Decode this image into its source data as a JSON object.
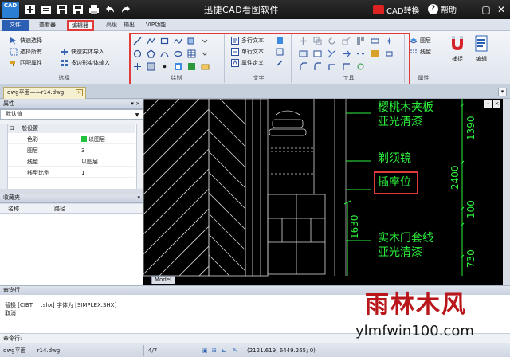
{
  "window": {
    "title": "迅捷CAD看图软件",
    "cad_convert": "CAD转换",
    "help": "帮助",
    "logo": "CAD"
  },
  "menu": {
    "tabs": [
      "文件",
      "查看器",
      "编辑器",
      "高级",
      "输出",
      "VIP功能"
    ],
    "active": "编辑器"
  },
  "ribbon": {
    "select_group": {
      "label": "选择",
      "items": [
        "快速选择",
        "选择所有",
        "匹配属性"
      ],
      "items_right": [
        "快速实体导入",
        "多边形实体输入"
      ]
    },
    "draw_group": {
      "label": "绘制"
    },
    "text_group": {
      "label": "文字",
      "items": [
        "多行文本",
        "单行文本",
        "属性定义"
      ]
    },
    "tools_group": {
      "label": "工具"
    },
    "props_group": {
      "label": "属性",
      "items": [
        "图层",
        "线型"
      ]
    },
    "capture_label": "捕捉",
    "edit_label": "编辑"
  },
  "doc_tab": {
    "label": "dwg平面——r14.dwg"
  },
  "properties_panel": {
    "title": "属性",
    "selector": "默认值",
    "category": "一般设置",
    "rows": [
      {
        "key": "色彩",
        "value": "以图层",
        "swatch": "#1fc23a"
      },
      {
        "key": "图层",
        "value": "3"
      },
      {
        "key": "线型",
        "value": "以图层"
      },
      {
        "key": "线型比例",
        "value": "1"
      }
    ]
  },
  "favorites_panel": {
    "title": "收藏夹",
    "columns": [
      "名称",
      "路径"
    ]
  },
  "drawing": {
    "labels": [
      "樱桃木夹板",
      "亚光清漆",
      "剃须镜",
      "插座位",
      "实木门套线",
      "亚光清漆"
    ],
    "dims": [
      "1390",
      "2400",
      "100",
      "730",
      "1630"
    ],
    "model_tab": "Model"
  },
  "command": {
    "title": "命令行",
    "lines": [
      "替换 [CIBT___.shx] 字体为 [SIMPLEX.SHX]",
      "取消"
    ],
    "input_label": "命令行:"
  },
  "status": {
    "file": "dwg平面——r14.dwg",
    "page": "4/7",
    "coords": "(2121.619; 6449.265; 0)"
  },
  "watermark": {
    "cn": "雨林木风",
    "url": "ylmfwin100.com"
  }
}
